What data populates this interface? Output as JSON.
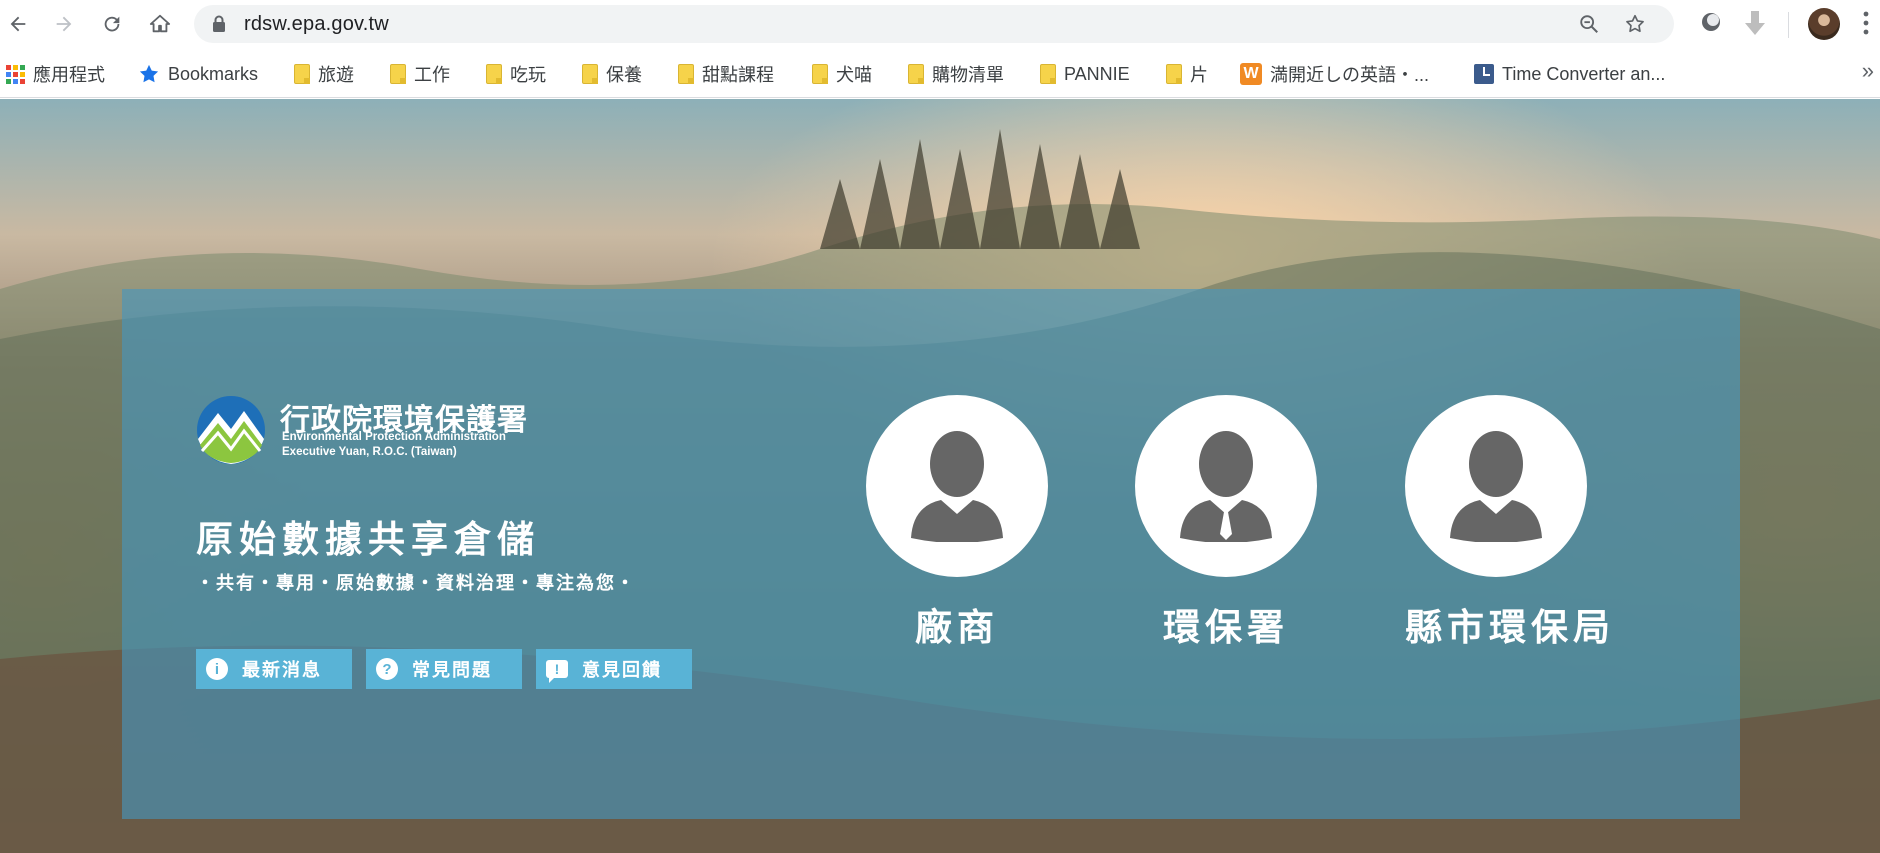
{
  "browser": {
    "url": "rdsw.epa.gov.tw",
    "bookmarks": [
      {
        "label": "應用程式",
        "icon": "apps-grid-icon"
      },
      {
        "label": "Bookmarks",
        "icon": "star-icon"
      },
      {
        "label": "旅遊",
        "icon": "folder-icon"
      },
      {
        "label": "工作",
        "icon": "folder-icon"
      },
      {
        "label": "吃玩",
        "icon": "folder-icon"
      },
      {
        "label": "保養",
        "icon": "folder-icon"
      },
      {
        "label": "甜點課程",
        "icon": "folder-icon"
      },
      {
        "label": "犬喵",
        "icon": "folder-icon"
      },
      {
        "label": "購物清單",
        "icon": "folder-icon"
      },
      {
        "label": "PANNIE",
        "icon": "folder-icon"
      },
      {
        "label": "片",
        "icon": "folder-icon"
      },
      {
        "label": "満開近しの英語・...",
        "icon": "w-logo-icon"
      },
      {
        "label": "Time Converter an...",
        "icon": "clock-icon"
      }
    ],
    "overflow": "»"
  },
  "logo": {
    "name_cn": "行政院環境保護署",
    "name_en_line1": "Environmental Protection Administration",
    "name_en_line2": "Executive Yuan, R.O.C. (Taiwan)"
  },
  "site": {
    "title": "原始數據共享倉儲",
    "tagline": "・共有・專用・原始數據・資料治理・專注為您・"
  },
  "buttons": [
    {
      "label": "最新消息",
      "icon": "info-icon",
      "glyph": "i"
    },
    {
      "label": "常見問題",
      "icon": "question-icon",
      "glyph": "?"
    },
    {
      "label": "意見回饋",
      "icon": "feedback-icon",
      "glyph": "!"
    }
  ],
  "roles": [
    {
      "label": "廠商",
      "icon": "user-icon"
    },
    {
      "label": "環保署",
      "icon": "user-tie-icon"
    },
    {
      "label": "縣市環保局",
      "icon": "user-icon"
    }
  ],
  "colors": {
    "panel": "#4696be",
    "button": "#59b3d6",
    "avatar_gray": "#666666"
  }
}
